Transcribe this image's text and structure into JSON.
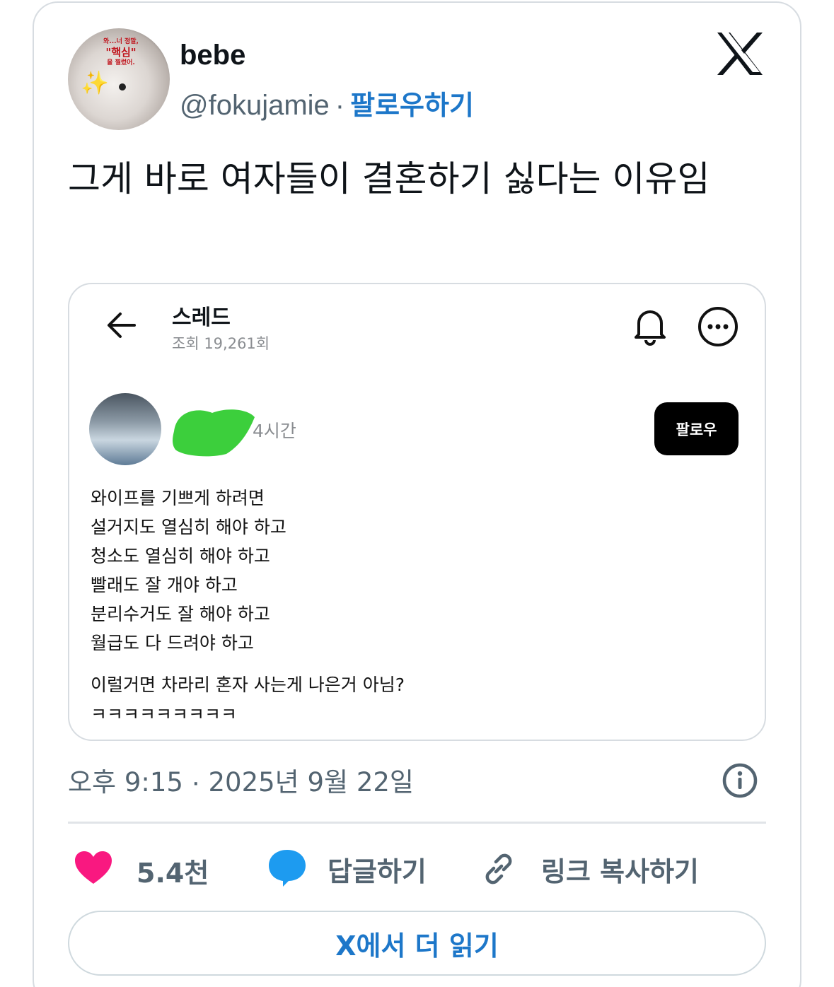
{
  "author": {
    "display_name": "bebe",
    "handle": "@fokujamie",
    "separator": "·",
    "follow_label": "팔로우하기",
    "avatar_text_line1": "와...너 정말,",
    "avatar_text_line2": "\"핵심\"",
    "avatar_text_line3": "을 찔렀어."
  },
  "tweet": {
    "text": "그게 바로 여자들이 결혼하기 싫다는 이유임",
    "timestamp_time": "오후 9:15",
    "timestamp_sep": "·",
    "timestamp_date": "2025년 9월 22일"
  },
  "embed": {
    "title": "스레드",
    "views": "조회 19,261회",
    "time_ago": "4시간",
    "follow_button": "팔로우",
    "lines": [
      "와이프를 기쁘게 하려면",
      "설거지도 열심히 해야 하고",
      "청소도 열심히 해야 하고",
      "빨래도 잘 개야 하고",
      "분리수거도 잘 해야 하고",
      "월급도 다 드려야 하고"
    ],
    "question": "이럴거면 차라리 혼자 사는게 나은거 아님?",
    "laugh": "ㅋㅋㅋㅋㅋㅋㅋㅋㅋ"
  },
  "actions": {
    "likes": "5.4천",
    "reply_label": "답글하기",
    "copy_link_label": "링크 복사하기",
    "read_more_label": "X에서 더 읽기"
  },
  "colors": {
    "link_blue": "#1d77c9",
    "heart_pink": "#f91880",
    "reply_blue": "#1d9bf0",
    "muted": "#536471"
  },
  "icons": [
    "x-logo-icon",
    "back-arrow-icon",
    "bell-icon",
    "more-icon",
    "heart-icon",
    "reply-bubble-icon",
    "link-icon",
    "info-icon"
  ]
}
